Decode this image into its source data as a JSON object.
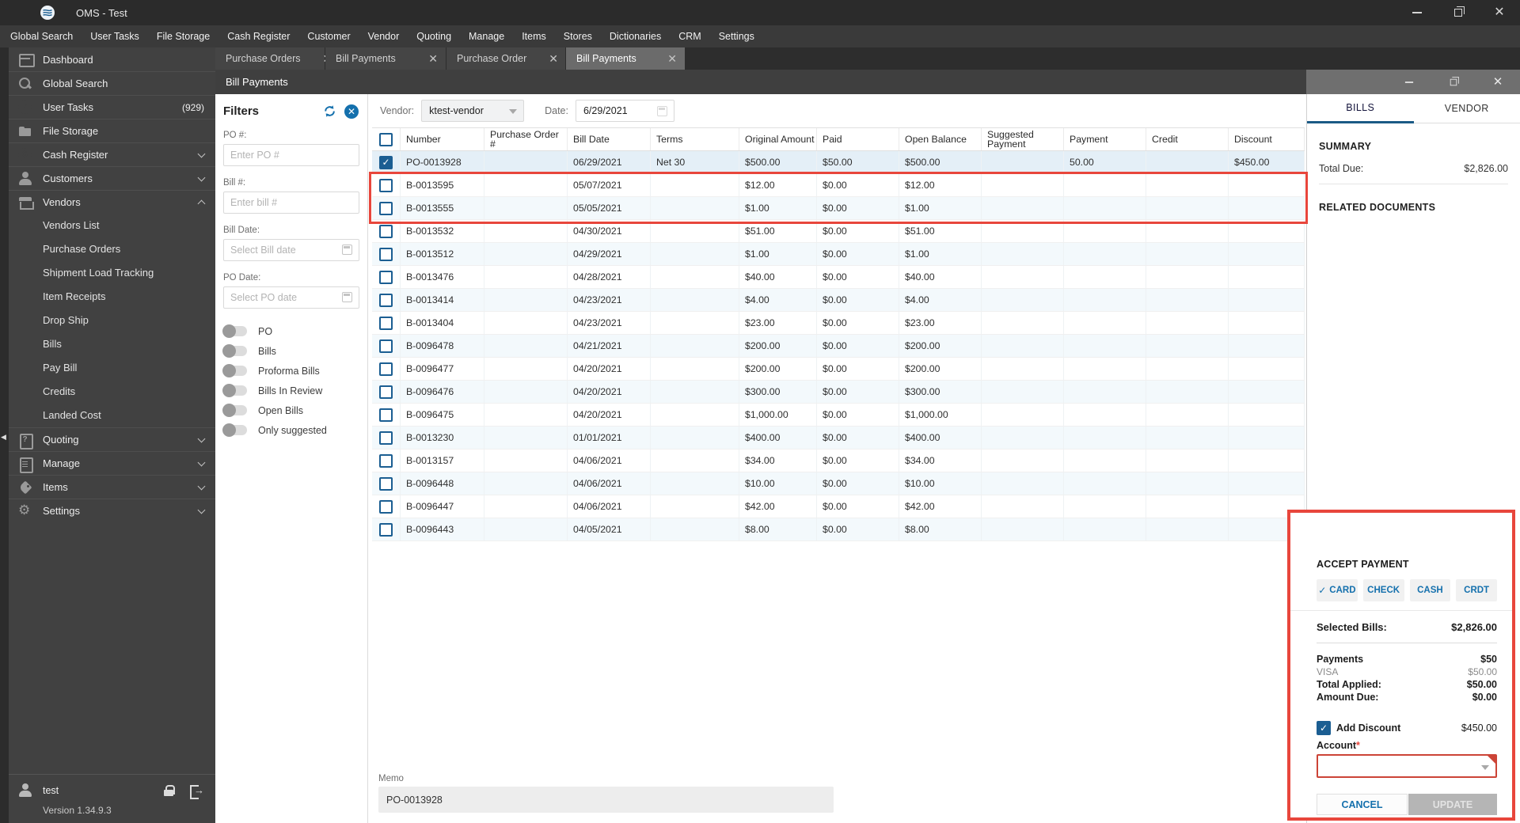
{
  "window": {
    "title": "OMS - Test"
  },
  "menu_bar": {
    "items": [
      "Global Search",
      "User Tasks",
      "File Storage",
      "Cash Register",
      "Customer",
      "Vendor",
      "Quoting",
      "Manage",
      "Items",
      "Stores",
      "Dictionaries",
      "CRM",
      "Settings"
    ]
  },
  "tabs": [
    {
      "label": "Purchase Orders",
      "active": false
    },
    {
      "label": "Bill Payments",
      "active": false
    },
    {
      "label": "Purchase Order",
      "active": false
    },
    {
      "label": "Bill Payments",
      "active": true
    }
  ],
  "page": {
    "title": "Bill Payments"
  },
  "sidebar": {
    "items": [
      {
        "label": "Dashboard",
        "icon": "dashboard"
      },
      {
        "label": "Global Search",
        "icon": "search"
      },
      {
        "label": "User Tasks",
        "icon": "tasks",
        "badge": "(929)"
      },
      {
        "label": "File Storage",
        "icon": "folder"
      },
      {
        "label": "Cash Register",
        "icon": "dollar",
        "chevron": "down"
      },
      {
        "label": "Customers",
        "icon": "person",
        "chevron": "down"
      },
      {
        "label": "Vendors",
        "icon": "store",
        "chevron": "up",
        "children": [
          "Vendors List",
          "Purchase Orders",
          "Shipment Load Tracking",
          "Item Receipts",
          "Drop Ship",
          "Bills",
          "Pay Bill",
          "Credits",
          "Landed Cost"
        ]
      },
      {
        "label": "Quoting",
        "icon": "quoting",
        "chevron": "down"
      },
      {
        "label": "Manage",
        "icon": "manage",
        "chevron": "down"
      },
      {
        "label": "Items",
        "icon": "tag",
        "chevron": "down"
      },
      {
        "label": "Settings",
        "icon": "gear",
        "chevron": "down"
      }
    ],
    "user": "test",
    "version": "Version 1.34.9.3"
  },
  "filters": {
    "title": "Filters",
    "po_label": "PO #:",
    "po_placeholder": "Enter PO #",
    "bill_label": "Bill #:",
    "bill_placeholder": "Enter bill #",
    "bill_date_label": "Bill Date:",
    "bill_date_placeholder": "Select Bill date",
    "po_date_label": "PO Date:",
    "po_date_placeholder": "Select PO date",
    "toggles": [
      {
        "label": "PO",
        "on": false
      },
      {
        "label": "Bills",
        "on": false
      },
      {
        "label": "Proforma Bills",
        "on": false
      },
      {
        "label": "Bills In Review",
        "on": false
      },
      {
        "label": "Open Bills",
        "on": false
      },
      {
        "label": "Only suggested",
        "on": false
      }
    ]
  },
  "toolbar": {
    "vendor_label": "Vendor:",
    "vendor_value": "ktest-vendor",
    "date_label": "Date:",
    "date_value": "6/29/2021"
  },
  "table": {
    "columns": [
      "Number",
      "Purchase Order #",
      "Bill Date",
      "Terms",
      "Original Amount",
      "Paid",
      "Open Balance",
      "Suggested Payment",
      "Payment",
      "Credit",
      "Discount"
    ],
    "rows": [
      {
        "checked": true,
        "selected": true,
        "number": "PO-0013928",
        "purchase_order": "",
        "bill_date": "06/29/2021",
        "terms": "Net 30",
        "original_amount": "$500.00",
        "paid": "$50.00",
        "open_balance": "$500.00",
        "suggested_payment": "",
        "payment": "50.00",
        "credit": "",
        "discount": "$450.00"
      },
      {
        "checked": false,
        "number": "B-0013595",
        "purchase_order": "",
        "bill_date": "05/07/2021",
        "terms": "",
        "original_amount": "$12.00",
        "paid": "$0.00",
        "open_balance": "$12.00",
        "suggested_payment": "",
        "payment": "",
        "credit": "",
        "discount": ""
      },
      {
        "checked": false,
        "number": "B-0013555",
        "purchase_order": "",
        "bill_date": "05/05/2021",
        "terms": "",
        "original_amount": "$1.00",
        "paid": "$0.00",
        "open_balance": "$1.00",
        "suggested_payment": "",
        "payment": "",
        "credit": "",
        "discount": ""
      },
      {
        "checked": false,
        "number": "B-0013532",
        "purchase_order": "",
        "bill_date": "04/30/2021",
        "terms": "",
        "original_amount": "$51.00",
        "paid": "$0.00",
        "open_balance": "$51.00",
        "suggested_payment": "",
        "payment": "",
        "credit": "",
        "discount": ""
      },
      {
        "checked": false,
        "number": "B-0013512",
        "purchase_order": "",
        "bill_date": "04/29/2021",
        "terms": "",
        "original_amount": "$1.00",
        "paid": "$0.00",
        "open_balance": "$1.00",
        "suggested_payment": "",
        "payment": "",
        "credit": "",
        "discount": ""
      },
      {
        "checked": false,
        "number": "B-0013476",
        "purchase_order": "",
        "bill_date": "04/28/2021",
        "terms": "",
        "original_amount": "$40.00",
        "paid": "$0.00",
        "open_balance": "$40.00",
        "suggested_payment": "",
        "payment": "",
        "credit": "",
        "discount": ""
      },
      {
        "checked": false,
        "number": "B-0013414",
        "purchase_order": "",
        "bill_date": "04/23/2021",
        "terms": "",
        "original_amount": "$4.00",
        "paid": "$0.00",
        "open_balance": "$4.00",
        "suggested_payment": "",
        "payment": "",
        "credit": "",
        "discount": ""
      },
      {
        "checked": false,
        "number": "B-0013404",
        "purchase_order": "",
        "bill_date": "04/23/2021",
        "terms": "",
        "original_amount": "$23.00",
        "paid": "$0.00",
        "open_balance": "$23.00",
        "suggested_payment": "",
        "payment": "",
        "credit": "",
        "discount": ""
      },
      {
        "checked": false,
        "number": "B-0096478",
        "purchase_order": "",
        "bill_date": "04/21/2021",
        "terms": "",
        "original_amount": "$200.00",
        "paid": "$0.00",
        "open_balance": "$200.00",
        "suggested_payment": "",
        "payment": "",
        "credit": "",
        "discount": ""
      },
      {
        "checked": false,
        "number": "B-0096477",
        "purchase_order": "",
        "bill_date": "04/20/2021",
        "terms": "",
        "original_amount": "$200.00",
        "paid": "$0.00",
        "open_balance": "$200.00",
        "suggested_payment": "",
        "payment": "",
        "credit": "",
        "discount": ""
      },
      {
        "checked": false,
        "number": "B-0096476",
        "purchase_order": "",
        "bill_date": "04/20/2021",
        "terms": "",
        "original_amount": "$300.00",
        "paid": "$0.00",
        "open_balance": "$300.00",
        "suggested_payment": "",
        "payment": "",
        "credit": "",
        "discount": ""
      },
      {
        "checked": false,
        "number": "B-0096475",
        "purchase_order": "",
        "bill_date": "04/20/2021",
        "terms": "",
        "original_amount": "$1,000.00",
        "paid": "$0.00",
        "open_balance": "$1,000.00",
        "suggested_payment": "",
        "payment": "",
        "credit": "",
        "discount": ""
      },
      {
        "checked": false,
        "number": "B-0013230",
        "purchase_order": "",
        "bill_date": "01/01/2021",
        "terms": "",
        "original_amount": "$400.00",
        "paid": "$0.00",
        "open_balance": "$400.00",
        "suggested_payment": "",
        "payment": "",
        "credit": "",
        "discount": ""
      },
      {
        "checked": false,
        "number": "B-0013157",
        "purchase_order": "",
        "bill_date": "04/06/2021",
        "terms": "",
        "original_amount": "$34.00",
        "paid": "$0.00",
        "open_balance": "$34.00",
        "suggested_payment": "",
        "payment": "",
        "credit": "",
        "discount": ""
      },
      {
        "checked": false,
        "number": "B-0096448",
        "purchase_order": "",
        "bill_date": "04/06/2021",
        "terms": "",
        "original_amount": "$10.00",
        "paid": "$0.00",
        "open_balance": "$10.00",
        "suggested_payment": "",
        "payment": "",
        "credit": "",
        "discount": ""
      },
      {
        "checked": false,
        "number": "B-0096447",
        "purchase_order": "",
        "bill_date": "04/06/2021",
        "terms": "",
        "original_amount": "$42.00",
        "paid": "$0.00",
        "open_balance": "$42.00",
        "suggested_payment": "",
        "payment": "",
        "credit": "",
        "discount": ""
      },
      {
        "checked": false,
        "number": "B-0096443",
        "purchase_order": "",
        "bill_date": "04/05/2021",
        "terms": "",
        "original_amount": "$8.00",
        "paid": "$0.00",
        "open_balance": "$8.00",
        "suggested_payment": "",
        "payment": "",
        "credit": "",
        "discount": ""
      }
    ]
  },
  "memo": {
    "label": "Memo",
    "value": "PO-0013928"
  },
  "right_panel": {
    "tabs": [
      "BILLS",
      "VENDOR"
    ],
    "active_tab": "BILLS",
    "summary_title": "SUMMARY",
    "total_due_label": "Total Due:",
    "total_due_value": "$2,826.00",
    "related_documents_title": "RELATED DOCUMENTS"
  },
  "payment_panel": {
    "title": "ACCEPT PAYMENT",
    "methods": [
      {
        "label": "CARD",
        "selected": true
      },
      {
        "label": "CHECK",
        "selected": false
      },
      {
        "label": "CASH",
        "selected": false
      },
      {
        "label": "CRDT",
        "selected": false
      }
    ],
    "selected_bills_label": "Selected Bills:",
    "selected_bills_value": "$2,826.00",
    "payments_label": "Payments",
    "payments_value": "$50",
    "visa_label": "VISA",
    "visa_value": "$50.00",
    "total_applied_label": "Total Applied:",
    "total_applied_value": "$50.00",
    "amount_due_label": "Amount Due:",
    "amount_due_value": "$0.00",
    "add_discount_label": "Add Discount",
    "add_discount_value": "$450.00",
    "add_discount_checked": true,
    "account_label": "Account",
    "cancel_label": "CANCEL",
    "update_label": "UPDATE"
  },
  "colors": {
    "accent_blue": "#1470ad",
    "checkbox_blue": "#1b5e92",
    "annotation_red": "#e8463c",
    "selected_row": "#e4eff7",
    "titlebar": "#2b2b2b",
    "sidebar": "#414141"
  }
}
